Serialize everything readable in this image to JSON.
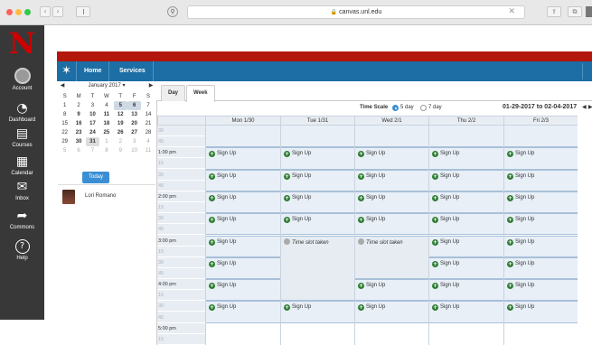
{
  "browser": {
    "url": "canvas.unl.edu",
    "lock_glyph": "🔒",
    "close_glyph": "✕",
    "back_glyph": "‹",
    "forward_glyph": "›",
    "pin_glyph": "⚲",
    "share_glyph": "⇪",
    "tabs_glyph": "⧉"
  },
  "global_nav": {
    "logo": "N",
    "items": [
      {
        "label": "Account",
        "icon": "account-icon"
      },
      {
        "label": "Dashboard",
        "icon": "dashboard-icon",
        "glyph": "◔"
      },
      {
        "label": "Courses",
        "icon": "courses-icon",
        "glyph": "▤"
      },
      {
        "label": "Calendar",
        "icon": "calendar-icon",
        "glyph": "▦"
      },
      {
        "label": "Inbox",
        "icon": "inbox-icon",
        "glyph": "✉"
      },
      {
        "label": "Commons",
        "icon": "commons-icon",
        "glyph": "➦"
      },
      {
        "label": "Help",
        "icon": "help-icon",
        "glyph": "?"
      }
    ]
  },
  "header": {
    "logo_glyph": "✶",
    "home": "Home",
    "services": "Services"
  },
  "mini_calendar": {
    "month": "January 2017 ▾",
    "prev": "◀",
    "next": "▶",
    "dow": [
      "S",
      "M",
      "T",
      "W",
      "T",
      "F",
      "S"
    ],
    "weeks": [
      [
        "1",
        "2",
        "3",
        "4",
        "5",
        "6",
        "7"
      ],
      [
        "8",
        "9",
        "10",
        "11",
        "12",
        "13",
        "14"
      ],
      [
        "15",
        "16",
        "17",
        "18",
        "19",
        "20",
        "21"
      ],
      [
        "22",
        "23",
        "24",
        "25",
        "26",
        "27",
        "28"
      ],
      [
        "29",
        "30",
        "31",
        "1",
        "2",
        "3",
        "4"
      ],
      [
        "5",
        "6",
        "7",
        "8",
        "9",
        "10",
        "11"
      ]
    ],
    "today_label": "Today",
    "user_name": "Lori Romano"
  },
  "view_tabs": {
    "day": "Day",
    "week": "Week"
  },
  "toolbar": {
    "time_scale": "Time Scale",
    "opt_5day": "5 day",
    "opt_7day": "7 day",
    "range": "01-29-2017 to 02-04-2017",
    "prev": "◀",
    "next": "▶"
  },
  "columns": [
    "Mon 1/30",
    "Tue 1/31",
    "Wed 2/1",
    "Thu 2/2",
    "Fri 2/3"
  ],
  "time_labels": [
    "30",
    "45",
    "1:00 pm",
    "15",
    "30",
    "45",
    "2:00 pm",
    "15",
    "30",
    "45",
    "3:00 pm",
    "15",
    "30",
    "45",
    "4:00 pm",
    "15",
    "30",
    "45",
    "5:00 pm",
    "15"
  ],
  "signup_label": "Sign Up",
  "taken_label": "Time slot taken",
  "plus_glyph": "+"
}
